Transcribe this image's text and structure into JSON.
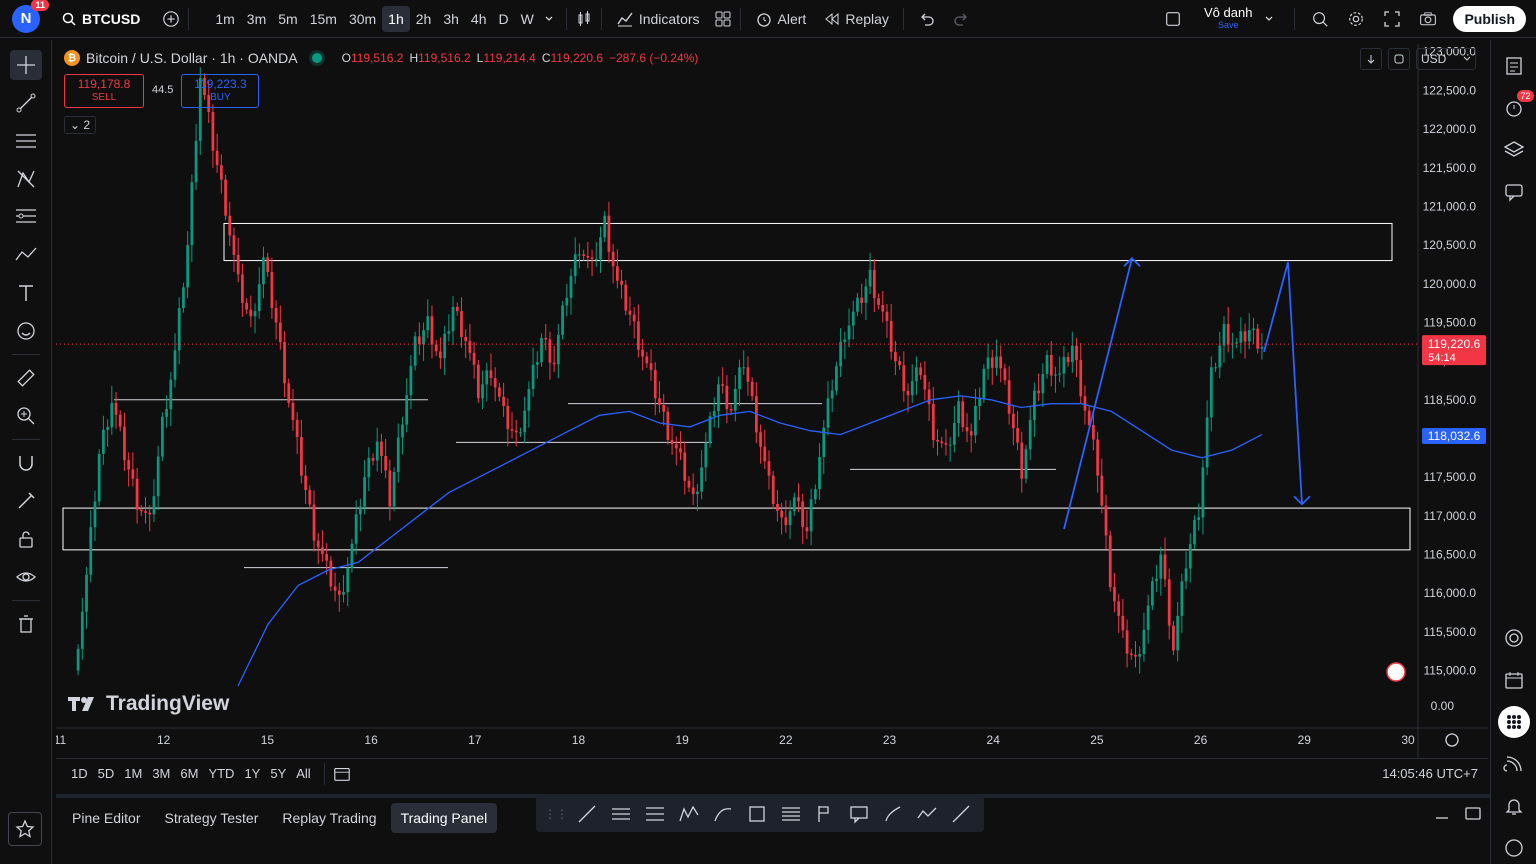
{
  "app": {
    "notification_count": "11",
    "symbol": "BTCUSD",
    "intervals": [
      "1m",
      "3m",
      "5m",
      "15m",
      "30m",
      "1h",
      "2h",
      "3h",
      "4h",
      "D",
      "W"
    ],
    "active_interval": "1h",
    "indicators_label": "Indicators",
    "alert_label": "Alert",
    "replay_label": "Replay",
    "user_name": "Vô danh",
    "user_save": "Save",
    "publish_label": "Publish",
    "right_badge": "72"
  },
  "legend": {
    "title": "Bitcoin / U.S. Dollar · 1h · OANDA",
    "o_label": "O",
    "o_value": "119,516.2",
    "h_label": "H",
    "h_value": "119,516.2",
    "l_label": "L",
    "l_value": "119,214.4",
    "c_label": "C",
    "c_value": "119,220.6",
    "change": "−287.6 (−0.24%)"
  },
  "trade": {
    "sell_price": "119,178.8",
    "sell_label": "SELL",
    "spread": "44.5",
    "buy_price": "119,223.3",
    "buy_label": "BUY",
    "collapse": "2"
  },
  "currency": "USD",
  "watermark": "TradingView",
  "chart_data": {
    "type": "candlestick",
    "title": "Bitcoin / U.S. Dollar · 1h · OANDA",
    "y_ticks": [
      123000,
      122500,
      122000,
      121500,
      121000,
      120500,
      120000,
      119500,
      119000,
      118500,
      118000,
      117500,
      117000,
      116500,
      116000,
      115500,
      115000
    ],
    "y_tick_labels": [
      "123,000.0",
      "122,500.0",
      "122,000.0",
      "121,500.0",
      "121,000.0",
      "120,500.0",
      "120,000.0",
      "119,500.0",
      "119,000.0",
      "118,500.0",
      "118,000.0",
      "117,500.0",
      "117,000.0",
      "116,500.0",
      "116,000.0",
      "115,500.0",
      "115,000.0",
      "0.00"
    ],
    "ylim": [
      114800,
      123100
    ],
    "x_tick_labels": [
      "11",
      "12",
      "15",
      "16",
      "17",
      "18",
      "19",
      "22",
      "23",
      "24",
      "25",
      "26",
      "29",
      "30"
    ],
    "last_price": 119220.6,
    "last_price_label": "119,220.6",
    "countdown": "54:14",
    "ma_price": 118032.6,
    "ma_price_label": "118,032.6",
    "candle_close_path": [
      115000,
      116200,
      117800,
      118500,
      117800,
      117200,
      116900,
      118200,
      119100,
      120500,
      122700,
      121800,
      121000,
      120000,
      119500,
      120300,
      119500,
      118500,
      117600,
      116800,
      116300,
      115900,
      116600,
      117500,
      118000,
      117200,
      118300,
      119200,
      119500,
      119000,
      119700,
      119300,
      118600,
      118900,
      118300,
      118000,
      118600,
      119300,
      119000,
      119900,
      120500,
      120200,
      120800,
      120000,
      119600,
      119100,
      118600,
      118100,
      117700,
      117200,
      117900,
      118700,
      118400,
      119000,
      118200,
      117400,
      116900,
      117200,
      116800,
      117800,
      118700,
      119400,
      119700,
      120100,
      119600,
      119000,
      118600,
      118900,
      118100,
      117800,
      118400,
      118000,
      118900,
      119100,
      118400,
      117600,
      118500,
      119000,
      118800,
      119200,
      118400,
      117600,
      116200,
      115400,
      115100,
      115800,
      116500,
      115300,
      116400,
      117100,
      118800,
      119400,
      119200,
      119400,
      119220
    ],
    "ma_path": [
      114800,
      115600,
      116100,
      116300,
      116400,
      116700,
      117000,
      117300,
      117500,
      117700,
      117900,
      118100,
      118300,
      118350,
      118200,
      118150,
      118300,
      118350,
      118200,
      118100,
      118050,
      118200,
      118350,
      118500,
      118550,
      118500,
      118400,
      118450,
      118450,
      118350,
      118100,
      117850,
      117750,
      117850,
      118050
    ],
    "support_resistance_zones": [
      {
        "top": 120780,
        "bottom": 120300
      },
      {
        "top": 117100,
        "bottom": 116560
      }
    ],
    "horizontal_lines": [
      118500,
      118450,
      117950,
      117600,
      116330
    ],
    "projection_path_1": [
      116830,
      120330
    ],
    "projection_path_2": [
      119120,
      120280,
      117150
    ]
  },
  "range": [
    "1D",
    "5D",
    "1M",
    "3M",
    "6M",
    "YTD",
    "1Y",
    "5Y",
    "All"
  ],
  "clock": "14:05:46 UTC+7",
  "bottom_tabs": [
    "Pine Editor",
    "Strategy Tester",
    "Replay Trading",
    "Trading Panel"
  ],
  "active_bottom_tab": "Trading Panel",
  "colors": {
    "up": "#089981",
    "down": "#f23645",
    "ma": "#2962ff",
    "bg": "#0f0f0f"
  }
}
